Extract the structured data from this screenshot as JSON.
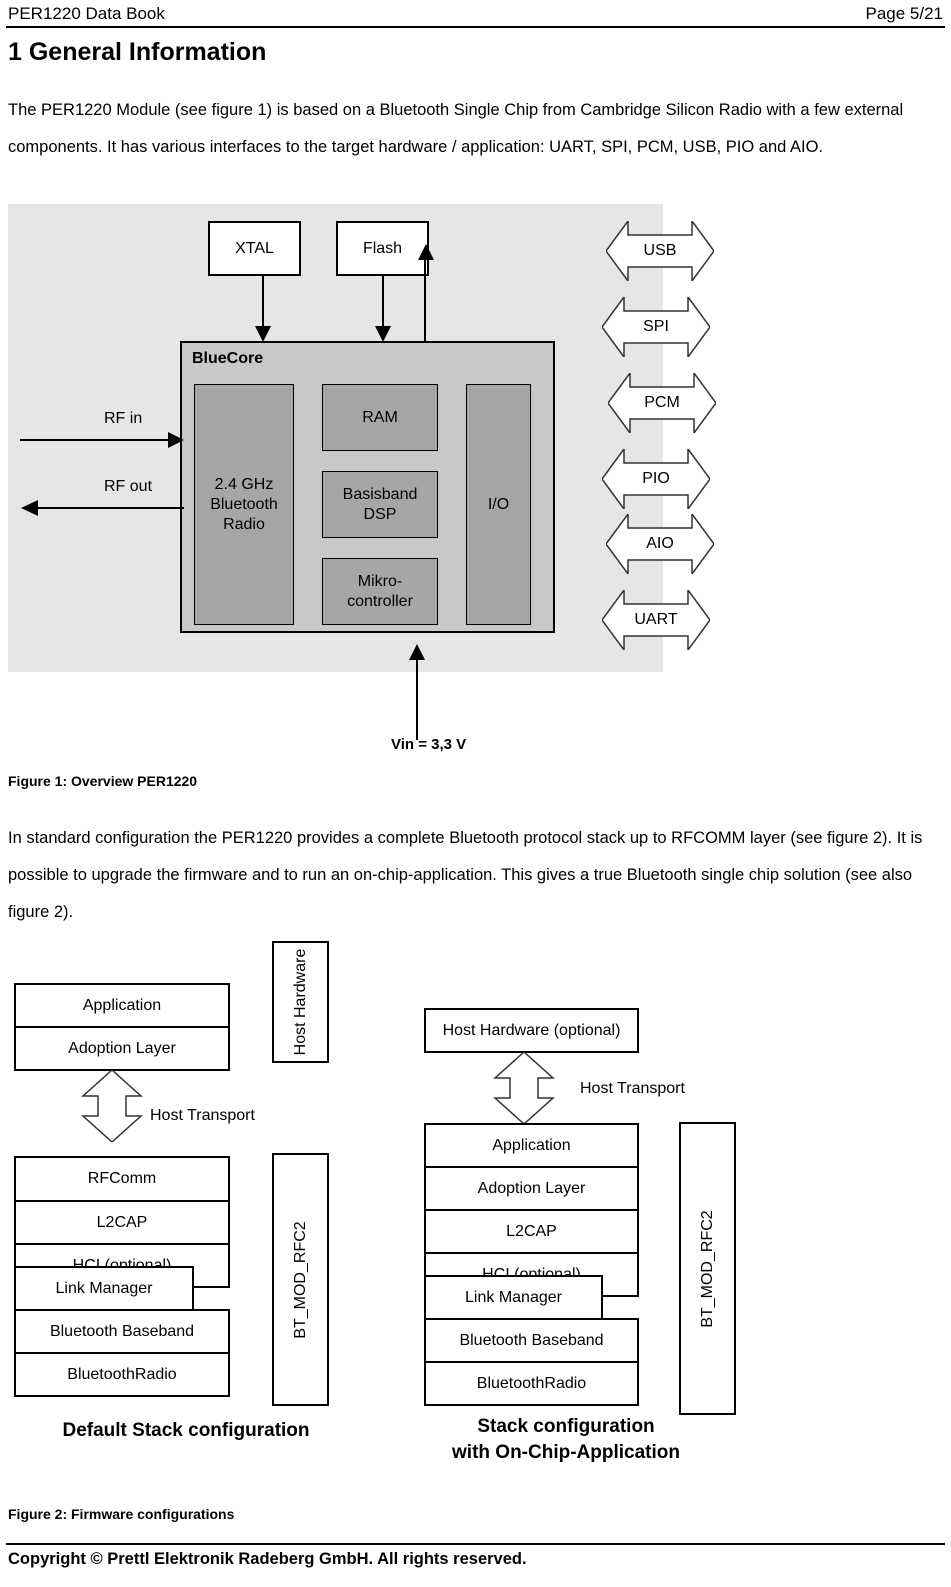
{
  "header": {
    "left": "PER1220 Data Book",
    "right": "Page 5/21"
  },
  "section": {
    "title": "1 General Information",
    "paragraph_1": "The PER1220 Module (see figure 1) is based on a Bluetooth Single Chip from Cambridge Silicon Radio with a few external components. It has various interfaces to the target hardware / application: UART, SPI, PCM, USB, PIO and AIO.",
    "paragraph_2": "In standard configuration the PER1220 provides a complete Bluetooth protocol stack up to RFCOMM layer (see figure 2). It is possible to upgrade the firmware and to run an on-chip-application. This gives a true Bluetooth single chip solution (see also figure 2)."
  },
  "figure1": {
    "caption": "Figure 1: Overview PER1220",
    "external_components": [
      {
        "label": "XTAL"
      },
      {
        "label": "Flash"
      }
    ],
    "chip": {
      "title": "BlueCore",
      "blocks": [
        {
          "label": "2.4 GHz\nBluetooth\nRadio",
          "line1": "2.4 GHz",
          "line2": "Bluetooth",
          "line3": "Radio"
        },
        {
          "label": "RAM"
        },
        {
          "label": "Basisband DSP",
          "line1": "Basisband",
          "line2": "DSP"
        },
        {
          "label": "Mikro-controller",
          "line1": "Mikro-",
          "line2": "controller"
        },
        {
          "label": "I/O"
        }
      ]
    },
    "rf_in_label": "RF in",
    "rf_out_label": "RF out",
    "power_label": "Vin = 3,3 V",
    "interfaces": [
      {
        "label": "USB"
      },
      {
        "label": "SPI"
      },
      {
        "label": "PCM"
      },
      {
        "label": "PIO"
      },
      {
        "label": "AIO"
      },
      {
        "label": "UART"
      }
    ],
    "colors": {
      "module_background": "#e6e6e6",
      "chip_background": "#c8c8c8",
      "block_background": "#a6a6a6"
    }
  },
  "figure2": {
    "caption": "Figure 2: Firmware configurations",
    "left": {
      "title": "Default Stack configuration",
      "host_stack": [
        {
          "label": "Application"
        },
        {
          "label": "Adoption Layer"
        }
      ],
      "transport_label": "Host Transport",
      "module_stack": [
        {
          "label": "RFComm"
        },
        {
          "label": "L2CAP"
        },
        {
          "label": "HCI (optional)"
        },
        {
          "label": "Link Manager"
        },
        {
          "label": "Bluetooth Baseband"
        },
        {
          "label": "BluetoothRadio"
        }
      ],
      "host_hardware_label": "Host Hardware",
      "module_label": "BT_MOD_RFC2"
    },
    "right": {
      "title_line1": "Stack configuration",
      "title_line2": "with On-Chip-Application",
      "host_hardware_label": "Host Hardware (optional)",
      "transport_label": "Host Transport",
      "module_stack": [
        {
          "label": "Application"
        },
        {
          "label": "Adoption Layer"
        },
        {
          "label": "L2CAP"
        },
        {
          "label": "HCI (optional)"
        },
        {
          "label": "Link Manager"
        },
        {
          "label": "Bluetooth Baseband"
        },
        {
          "label": "BluetoothRadio"
        }
      ],
      "module_label": "BT_MOD_RFC2"
    }
  },
  "footer": {
    "copyright": "Copyright © Prettl Elektronik Radeberg GmbH. All rights reserved."
  }
}
